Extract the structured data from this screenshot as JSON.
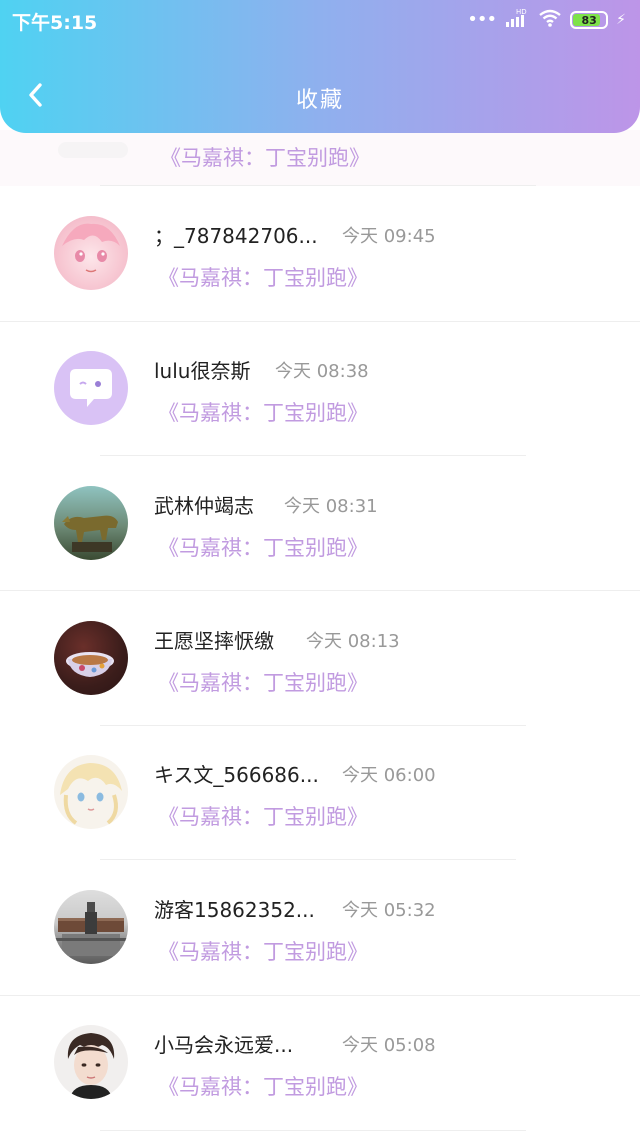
{
  "status_bar": {
    "time": "下午5:15",
    "signal_label": "HD",
    "battery": "83"
  },
  "header": {
    "title": "收藏",
    "back_icon": "chevron-left-icon"
  },
  "colors": {
    "gradient_start": "#4fd2f2",
    "gradient_end": "#bd95e8",
    "accent_text": "#c19be0",
    "muted": "#999999"
  },
  "partial_item": {
    "message": "《马嘉祺：丁宝别跑》"
  },
  "items": [
    {
      "name": "；_787842706...",
      "time": "今天 09:45",
      "message": "《马嘉祺：丁宝别跑》",
      "avatar": "anime-girl-pink"
    },
    {
      "name": "lulu很奈斯",
      "time": "今天 08:38",
      "message": "《马嘉祺：丁宝别跑》",
      "avatar": "chat-bubble-purple"
    },
    {
      "name": "武林仲竭志",
      "time": "今天 08:31",
      "message": "《马嘉祺：丁宝别跑》",
      "avatar": "bronze-horse"
    },
    {
      "name": "王愿坚摔恹缴",
      "time": "今天 08:13",
      "message": "《马嘉祺：丁宝别跑》",
      "avatar": "teacup"
    },
    {
      "name": "キス文_566686...",
      "time": "今天 06:00",
      "message": "《马嘉祺：丁宝别跑》",
      "avatar": "anime-blonde"
    },
    {
      "name": "游客15862352...",
      "time": "今天 05:32",
      "message": "《马嘉祺：丁宝别跑》",
      "avatar": "statue-building"
    },
    {
      "name": "小马会永远爱...",
      "time": "今天 05:08",
      "message": "《马嘉祺：丁宝别跑》",
      "avatar": "boy-portrait"
    }
  ]
}
